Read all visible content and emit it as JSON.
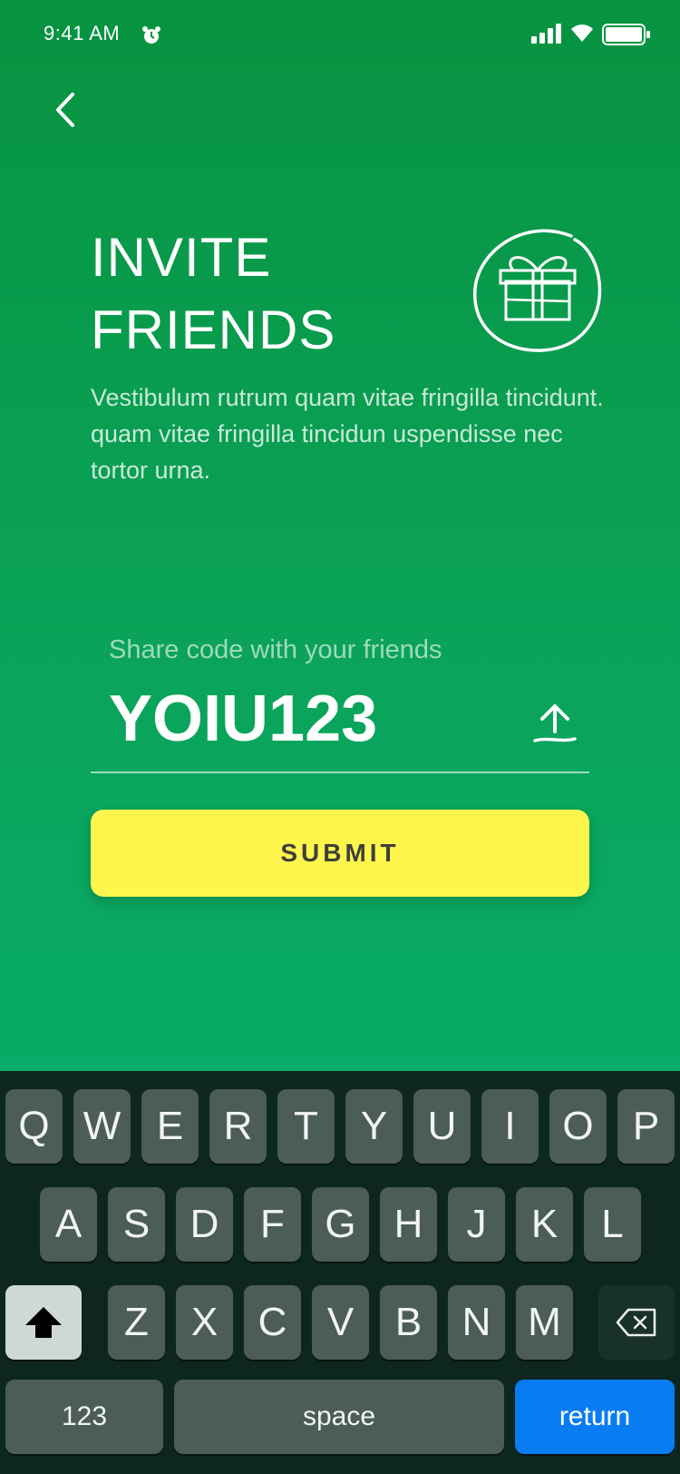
{
  "status_bar": {
    "time": "9:41 AM",
    "icons": [
      "alarm-icon",
      "signal-icon",
      "wifi-icon",
      "battery-icon"
    ]
  },
  "header": {
    "back_icon": "chevron-left-icon"
  },
  "invite": {
    "title_line1": "INVITE",
    "title_line2": "FRIENDS",
    "icon": "gift-icon",
    "description": "Vestibulum rutrum quam vitae fringilla tincidunt. quam vitae fringilla tincidun uspendisse nec tortor urna."
  },
  "share": {
    "label": "Share code with your friends",
    "code": "YOIU123",
    "share_icon": "upload-icon"
  },
  "submit_label": "SUBMIT",
  "keyboard": {
    "row1": [
      "Q",
      "W",
      "E",
      "R",
      "T",
      "Y",
      "U",
      "I",
      "O",
      "P"
    ],
    "row2": [
      "A",
      "S",
      "D",
      "F",
      "G",
      "H",
      "J",
      "K",
      "L"
    ],
    "row3": [
      "Z",
      "X",
      "C",
      "V",
      "B",
      "N",
      "M"
    ],
    "numbers_label": "123",
    "space_label": "space",
    "return_label": "return"
  },
  "colors": {
    "background_top": "#079340",
    "background_bottom": "#08ab67",
    "submit_button": "#fff64d",
    "return_key": "#0a7cf2",
    "keyboard_bg": "#0d2620"
  }
}
